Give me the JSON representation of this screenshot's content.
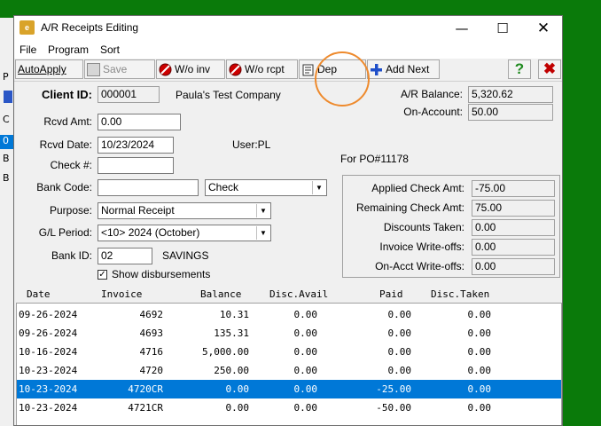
{
  "window": {
    "title": "A/R Receipts Editing",
    "app_icon": "e"
  },
  "menu": [
    "File",
    "Program",
    "Sort"
  ],
  "toolbar": {
    "autoapply": "AutoApply",
    "save": "Save",
    "wo_inv": "W/o inv",
    "wo_rcpt": "W/o rcpt",
    "dep": "Dep",
    "add_next": "Add Next"
  },
  "bg_rows": [
    "P",
    "C",
    "0",
    "B",
    "B"
  ],
  "form": {
    "client_id_label": "Client ID:",
    "client_id": "000001",
    "client_name": "Paula's Test Company",
    "ar_balance_label": "A/R Balance:",
    "ar_balance": "5,320.62",
    "on_account_label": "On-Account:",
    "on_account": "50.00",
    "rcvd_amt_label": "Rcvd Amt:",
    "rcvd_amt": "0.00",
    "rcvd_date_label": "Rcvd Date:",
    "rcvd_date": "10/23/2024",
    "user": "User:PL",
    "check_label": "Check #:",
    "check": "",
    "for_po": "For PO#11178",
    "bank_code_label": "Bank Code:",
    "bank_code": "",
    "pay_type": "Check",
    "purpose_label": "Purpose:",
    "purpose": "Normal Receipt",
    "gl_label": "G/L Period:",
    "gl_period": "<10> 2024 (October)",
    "bank_id_label": "Bank ID:",
    "bank_id": "02",
    "bank_name": "SAVINGS",
    "show_disb": "Show disbursements",
    "show_disb_checked": true
  },
  "summary": [
    {
      "label": "Applied Check Amt:",
      "value": "-75.00"
    },
    {
      "label": "Remaining Check Amt:",
      "value": "75.00"
    },
    {
      "label": "Discounts Taken:",
      "value": "0.00"
    },
    {
      "label": "Invoice Write-offs:",
      "value": "0.00"
    },
    {
      "label": "On-Acct Write-offs:",
      "value": "0.00"
    }
  ],
  "grid": {
    "columns": [
      "Date",
      "Invoice",
      "Balance",
      "Disc.Avail",
      "Paid",
      "Disc.Taken"
    ],
    "rows": [
      [
        "09-26-2024",
        "4692",
        "10.31",
        "0.00",
        "0.00",
        "0.00"
      ],
      [
        "09-26-2024",
        "4693",
        "135.31",
        "0.00",
        "0.00",
        "0.00"
      ],
      [
        "10-16-2024",
        "4716",
        "5,000.00",
        "0.00",
        "0.00",
        "0.00"
      ],
      [
        "10-23-2024",
        "4720",
        "250.00",
        "0.00",
        "0.00",
        "0.00"
      ],
      [
        "10-23-2024",
        "4720CR",
        "0.00",
        "0.00",
        "-25.00",
        "0.00"
      ],
      [
        "10-23-2024",
        "4721CR",
        "0.00",
        "0.00",
        "-50.00",
        "0.00"
      ]
    ],
    "selected_row": 4
  },
  "colors": {
    "accent": "#0078d7",
    "background": "#0a7a0a",
    "highlight_circle": "#ee8a2d"
  }
}
